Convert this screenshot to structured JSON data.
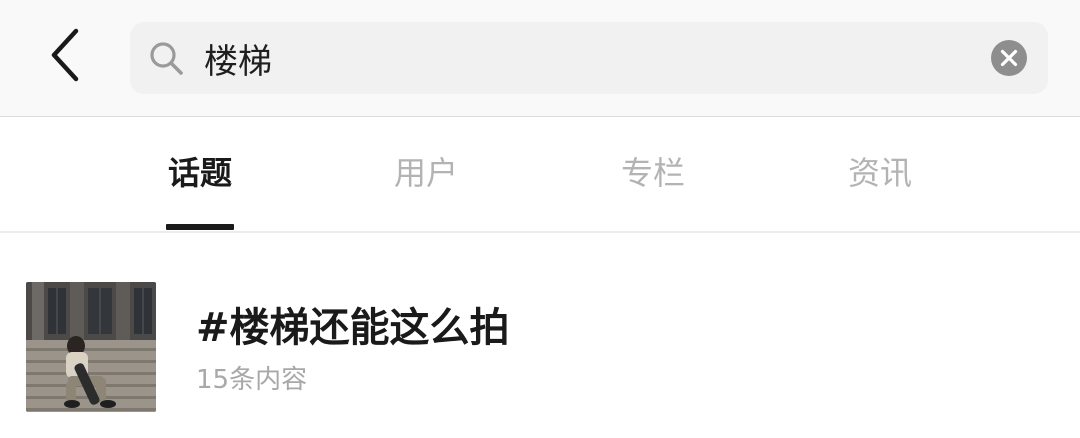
{
  "search": {
    "back_icon": "chevron-left-icon",
    "search_icon": "magnifier-icon",
    "query": "楼梯",
    "clear_icon": "close-circle-icon"
  },
  "tabs": [
    {
      "label": "话题",
      "active": true
    },
    {
      "label": "用户",
      "active": false
    },
    {
      "label": "专栏",
      "active": false
    },
    {
      "label": "资讯",
      "active": false
    }
  ],
  "results": [
    {
      "title": "#楼梯还能这么拍",
      "meta": "15条内容",
      "thumbnail": "photo-person-sitting-on-stairs"
    }
  ],
  "colors": {
    "header_bg": "#f9f9f9",
    "search_bg": "#f1f1f1",
    "active_tab": "#1a1a1a",
    "inactive_tab": "#b3b3b3",
    "meta_text": "#a8a8a8"
  }
}
